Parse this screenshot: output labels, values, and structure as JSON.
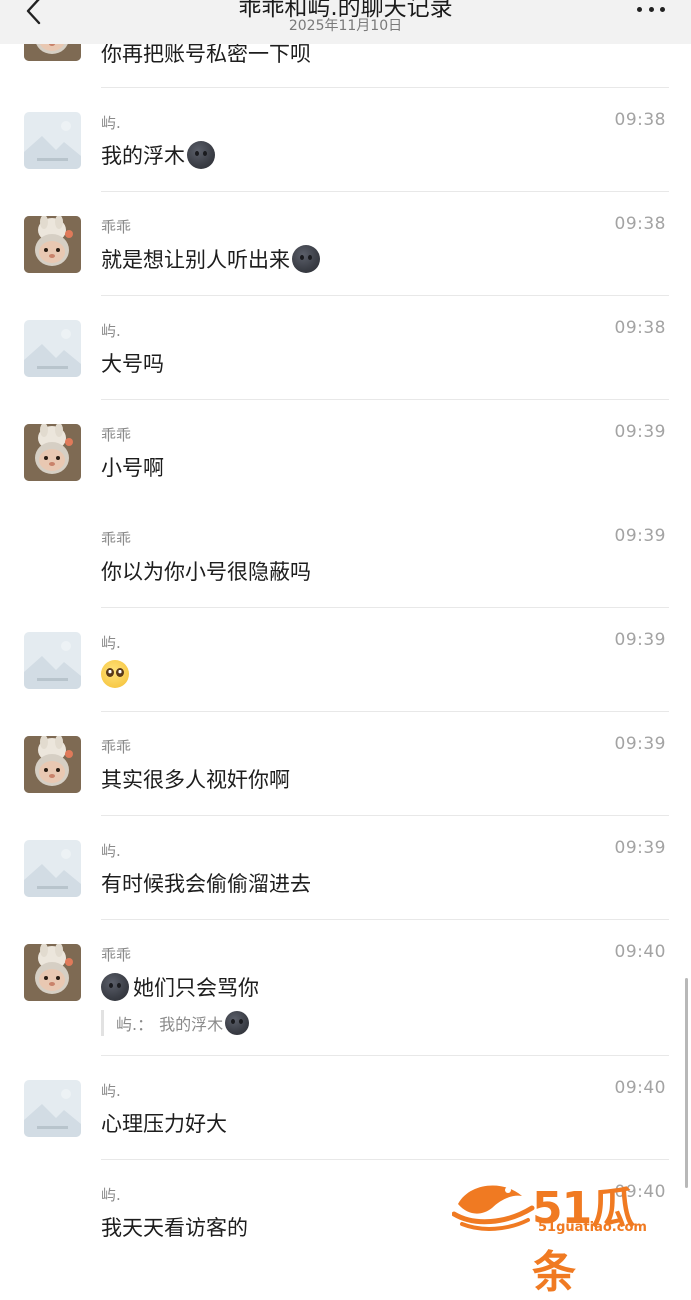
{
  "header": {
    "title": "乖乖和屿.的聊天记录",
    "date": "2025年11月10日"
  },
  "top_partial_text": "你再把账号私密一下呗",
  "messages": [
    {
      "sender": "屿.",
      "time": "09:38",
      "text": "我的浮木",
      "emoji": "dark-face-icon",
      "avatar": "placeholder"
    },
    {
      "sender": "乖乖",
      "time": "09:38",
      "text": "就是想让别人听出来",
      "emoji": "dark-face-icon",
      "avatar": "bunny"
    },
    {
      "sender": "屿.",
      "time": "09:38",
      "text": "大号吗",
      "avatar": "placeholder"
    },
    {
      "sender": "乖乖",
      "time": "09:39",
      "text": "小号啊",
      "avatar": "bunny"
    },
    {
      "sender": "乖乖",
      "time": "09:39",
      "text": "你以为你小号很隐蔽吗",
      "avatar": "none"
    },
    {
      "sender": "屿.",
      "time": "09:39",
      "text": "",
      "emoji": "pleading-face-icon",
      "avatar": "placeholder"
    },
    {
      "sender": "乖乖",
      "time": "09:39",
      "text": "其实很多人视奸你啊",
      "avatar": "bunny"
    },
    {
      "sender": "屿.",
      "time": "09:39",
      "text": "有时候我会偷偷溜进去",
      "avatar": "placeholder"
    },
    {
      "sender": "乖乖",
      "time": "09:40",
      "text": "她们只会骂你",
      "emoji": "dark-face-icon",
      "avatar": "bunny",
      "quote": {
        "author": "屿.：",
        "text": "我的浮木"
      }
    },
    {
      "sender": "屿.",
      "time": "09:40",
      "text": "心理压力好大",
      "avatar": "placeholder"
    },
    {
      "sender": "屿.",
      "time": "09:40",
      "text": "我天天看访客的",
      "avatar": "none"
    }
  ],
  "watermark": {
    "brand": "51瓜条",
    "url": "51guatiao.com",
    "color": "#f07a22"
  },
  "colors": {
    "header_bg": "#f2f2f2",
    "divider": "#e8e8e8",
    "meta_text": "#8a8a8a"
  }
}
